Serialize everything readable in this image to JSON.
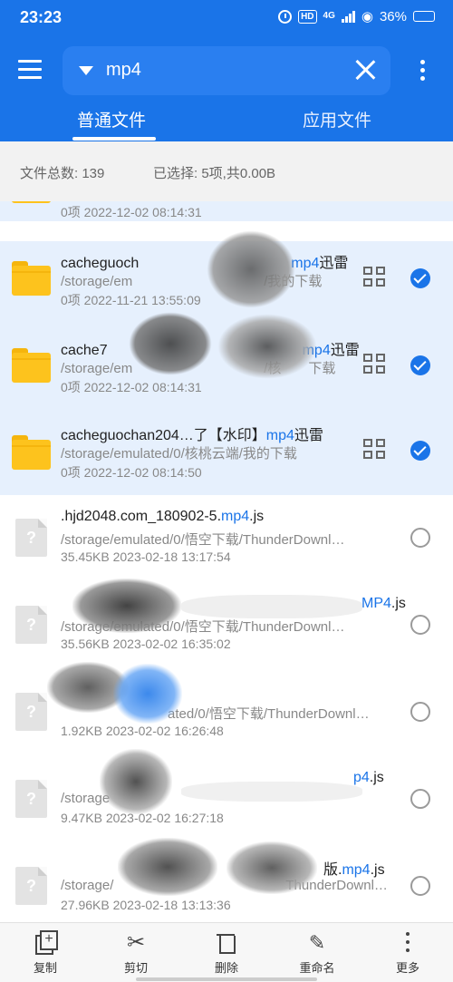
{
  "status_bar": {
    "time": "23:23",
    "battery_text": "36%",
    "battery_level": 0.36,
    "network": "4G",
    "hd_badge": "HD",
    "icons": [
      "alarm-icon",
      "hd-icon",
      "4g-icon",
      "signal-icon",
      "wifi-icon",
      "battery-icon"
    ]
  },
  "header": {
    "search_query": "mp4",
    "tabs": [
      {
        "label": "普通文件",
        "active": true
      },
      {
        "label": "应用文件",
        "active": false
      }
    ],
    "accent_color": "#1a74e8"
  },
  "summary": {
    "total": "文件总数: 139",
    "selected": "已选择: 5项,共0.00B"
  },
  "items": [
    {
      "type": "folder",
      "selected": true,
      "title": "",
      "path": "",
      "meta": "0项  2022-12-02 08:14:31"
    },
    {
      "type": "folder",
      "selected": true,
      "title_pre": "cacheguoch",
      "title_hl": "mp4",
      "title_post": "迅雷",
      "path": "/storage/em",
      "path_tail": "/我的下载",
      "meta": "0项  2022-11-21 13:55:09"
    },
    {
      "type": "folder",
      "selected": true,
      "title_pre": "cache7",
      "title_hl": "mp4",
      "title_post": "迅雷",
      "path": "/storage/em",
      "path_tail": "/核",
      "path_tail2": "下载",
      "meta": "0项  2022-12-02 08:14:31"
    },
    {
      "type": "folder",
      "selected": true,
      "title_pre": "cacheguochan204…了【水印】",
      "title_hl": "mp4",
      "title_post": "迅雷",
      "path": "/storage/emulated/0/核桃云端/我的下载",
      "meta": "0项  2022-12-02 08:14:50"
    },
    {
      "type": "file",
      "selected": false,
      "title_pre": ".hjd2048.com_180902-5.",
      "title_hl": "mp4",
      "title_post": ".js",
      "path": "/storage/emulated/0/悟空下载/ThunderDownl…",
      "meta": "35.45KB  2023-02-18 13:17:54"
    },
    {
      "type": "file",
      "selected": false,
      "title_pre": "",
      "title_hl": "MP4",
      "title_post": ".js",
      "path": "/storage/emulated/0/悟空下载/ThunderDownl…",
      "meta": "35.56KB  2023-02-02 16:35:02"
    },
    {
      "type": "file",
      "selected": false,
      "title_pre": "",
      "title_hl": "",
      "title_post": "",
      "path": "ated/0/悟空下载/ThunderDownl…",
      "meta": "1.92KB  2023-02-02 16:26:48"
    },
    {
      "type": "file",
      "selected": false,
      "title_pre": "",
      "title_hl": "p4",
      "title_post": ".js",
      "path": "/storage",
      "meta": "9.47KB  2023-02-02 16:27:18"
    },
    {
      "type": "file",
      "selected": false,
      "title_pre": "版.",
      "title_hl": "mp4",
      "title_post": ".js",
      "path": "/storage/",
      "path_tail": "ThunderDownl…",
      "meta": "27.96KB  2023-02-18 13:13:36"
    }
  ],
  "toolbar": {
    "copy": "复制",
    "cut": "剪切",
    "delete": "删除",
    "rename": "重命名",
    "more": "更多"
  }
}
